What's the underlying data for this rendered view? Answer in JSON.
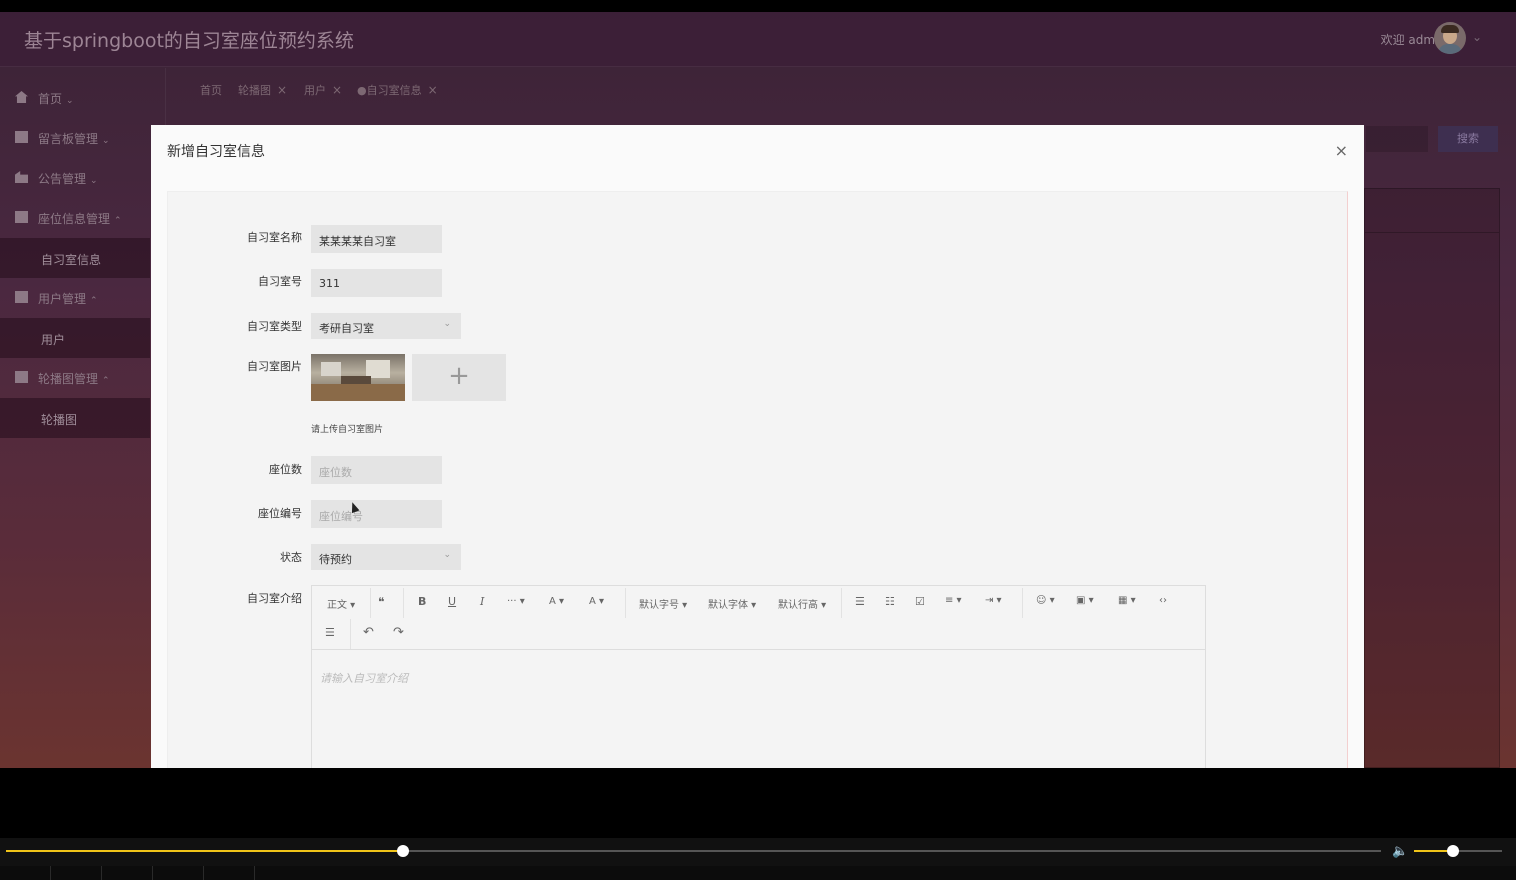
{
  "app": {
    "title": "基于springboot的自习室座位预约系统",
    "welcome": "欢迎 admin"
  },
  "sidebar": {
    "items": [
      {
        "label": "首页",
        "caret": "⌄"
      },
      {
        "label": "留言板管理",
        "caret": "⌄"
      },
      {
        "label": "公告管理",
        "caret": "⌄"
      },
      {
        "label": "座位信息管理",
        "caret": "⌃"
      },
      {
        "label": "用户管理",
        "caret": "⌃"
      },
      {
        "label": "轮播图管理",
        "caret": "⌃"
      }
    ],
    "subitems": [
      {
        "label": "自习室信息"
      },
      {
        "label": "用户"
      },
      {
        "label": "轮播图"
      }
    ]
  },
  "tabs": [
    {
      "label": "首页"
    },
    {
      "label": "轮播图"
    },
    {
      "label": "用户"
    },
    {
      "label": "●自习室信息"
    }
  ],
  "background": {
    "search_label": "搜索"
  },
  "modal": {
    "title": "新增自习室信息",
    "close": "×",
    "fields": {
      "name": {
        "label": "自习室名称",
        "value": "某某某某自习室"
      },
      "number": {
        "label": "自习室号",
        "value": "311"
      },
      "type": {
        "label": "自习室类型",
        "value": "考研自习室"
      },
      "image": {
        "label": "自习室图片",
        "hint": "请上传自习室图片",
        "add": "+"
      },
      "seats": {
        "label": "座位数",
        "placeholder": "座位数"
      },
      "seat_no": {
        "label": "座位编号",
        "placeholder": "座位编号"
      },
      "status": {
        "label": "状态",
        "value": "待预约"
      },
      "intro": {
        "label": "自习室介绍",
        "placeholder": "请输入自习室介绍"
      }
    },
    "toolbar": {
      "heading": "正文 ▾",
      "quote": "❝",
      "bold": "B",
      "underline": "U",
      "italic": "I",
      "more": "··· ▾",
      "font_color": "A ▾",
      "bg_color": "A ▾",
      "font_size": "默认字号 ▾",
      "font_family": "默认字体 ▾",
      "line_height": "默认行高 ▾",
      "bullet_list": "☰",
      "numbered_list": "☷",
      "todo": "☑",
      "align": "≡ ▾",
      "indent": "⇥ ▾",
      "emoji": "☺ ▾",
      "image": "▣ ▾",
      "table": "▦ ▾",
      "code": "‹›",
      "divider": "☰",
      "undo": "↶",
      "redo": "↷"
    }
  },
  "player": {
    "progress": 0.289,
    "volume": 0.44
  }
}
